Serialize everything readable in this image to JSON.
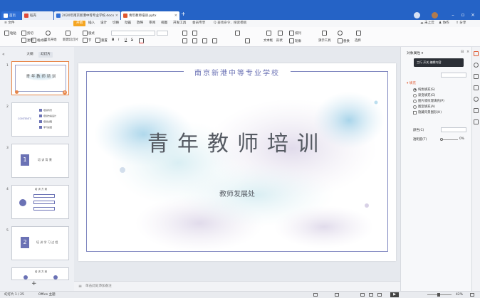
{
  "tabs": [
    {
      "label": "首页",
      "kind": "home"
    },
    {
      "label": "稻壳",
      "kind": "docer"
    },
    {
      "label": "2020年南京新港中等专业学校.docx",
      "kind": "word"
    },
    {
      "label": "青年教师培训.pptx",
      "kind": "ppt"
    }
  ],
  "titlebar": {
    "add_tab": "+"
  },
  "menu": {
    "file": "≡ 文件",
    "items": [
      "开始",
      "插入",
      "设计",
      "切换",
      "动画",
      "放映",
      "审阅",
      "视图",
      "开发工具",
      "会员专享"
    ],
    "search": "Q 查找命令、搜索模板",
    "right": [
      "☁ 未上云",
      "♟ 协作",
      "⇪ 分享"
    ]
  },
  "ribbon": {
    "row1": [
      "粘贴",
      "剪切",
      "复制",
      "格式刷",
      "当页开始",
      "新建幻灯片",
      "版式",
      "节",
      "重置"
    ],
    "row2": [
      "文本框",
      "形状",
      "排列",
      "轮廓",
      "演示工具",
      "替换",
      "选择"
    ],
    "font_style": [
      "B",
      "I",
      "U",
      "S"
    ]
  },
  "leftpanel": {
    "tab_outline": "大纲",
    "tab_slides": "幻灯片",
    "add": "+",
    "slides": [
      {
        "num": "1",
        "title": "青 年 教 师 培 训"
      },
      {
        "num": "2",
        "title": "CONTENTS",
        "items": [
          "培训背景",
          "培训方案设计",
          "培训过程",
          "学习总结"
        ]
      },
      {
        "num": "3",
        "title": "培 训 背 景",
        "big": "1"
      },
      {
        "num": "4",
        "title": "培 训 方 案",
        "big": ""
      },
      {
        "num": "5",
        "title": "培 训 学 习 过 程",
        "big": "2"
      },
      {
        "num": "6",
        "title": "培 训 方 案"
      }
    ]
  },
  "slide": {
    "header": "南京新港中等专业学校",
    "title": "青年教师培训",
    "subtitle": "教师发展处"
  },
  "notes": {
    "placeholder": "单击此处添加备注"
  },
  "rightpanel": {
    "title": "对象属性 ▾",
    "tooltip": "工行 开关 编辑内容",
    "section": "填充",
    "radios": [
      "纯色填充(S)",
      "渐变填充(G)",
      "图片或纹理填充(P)",
      "图案填充(A)",
      "隐藏背景图形(H)"
    ],
    "transparency_label": "透明度(T)",
    "transparency_value": "0%",
    "color_label": "颜色(C)"
  },
  "statusbar": {
    "slide_count": "幻灯片 1 / 25",
    "theme": "Office 主题",
    "zoom": "42%"
  },
  "colors": {
    "accent_blue": "#2563c6",
    "accent_orange": "#f5a623",
    "frame": "#7f86bf",
    "title": "#555a62"
  }
}
